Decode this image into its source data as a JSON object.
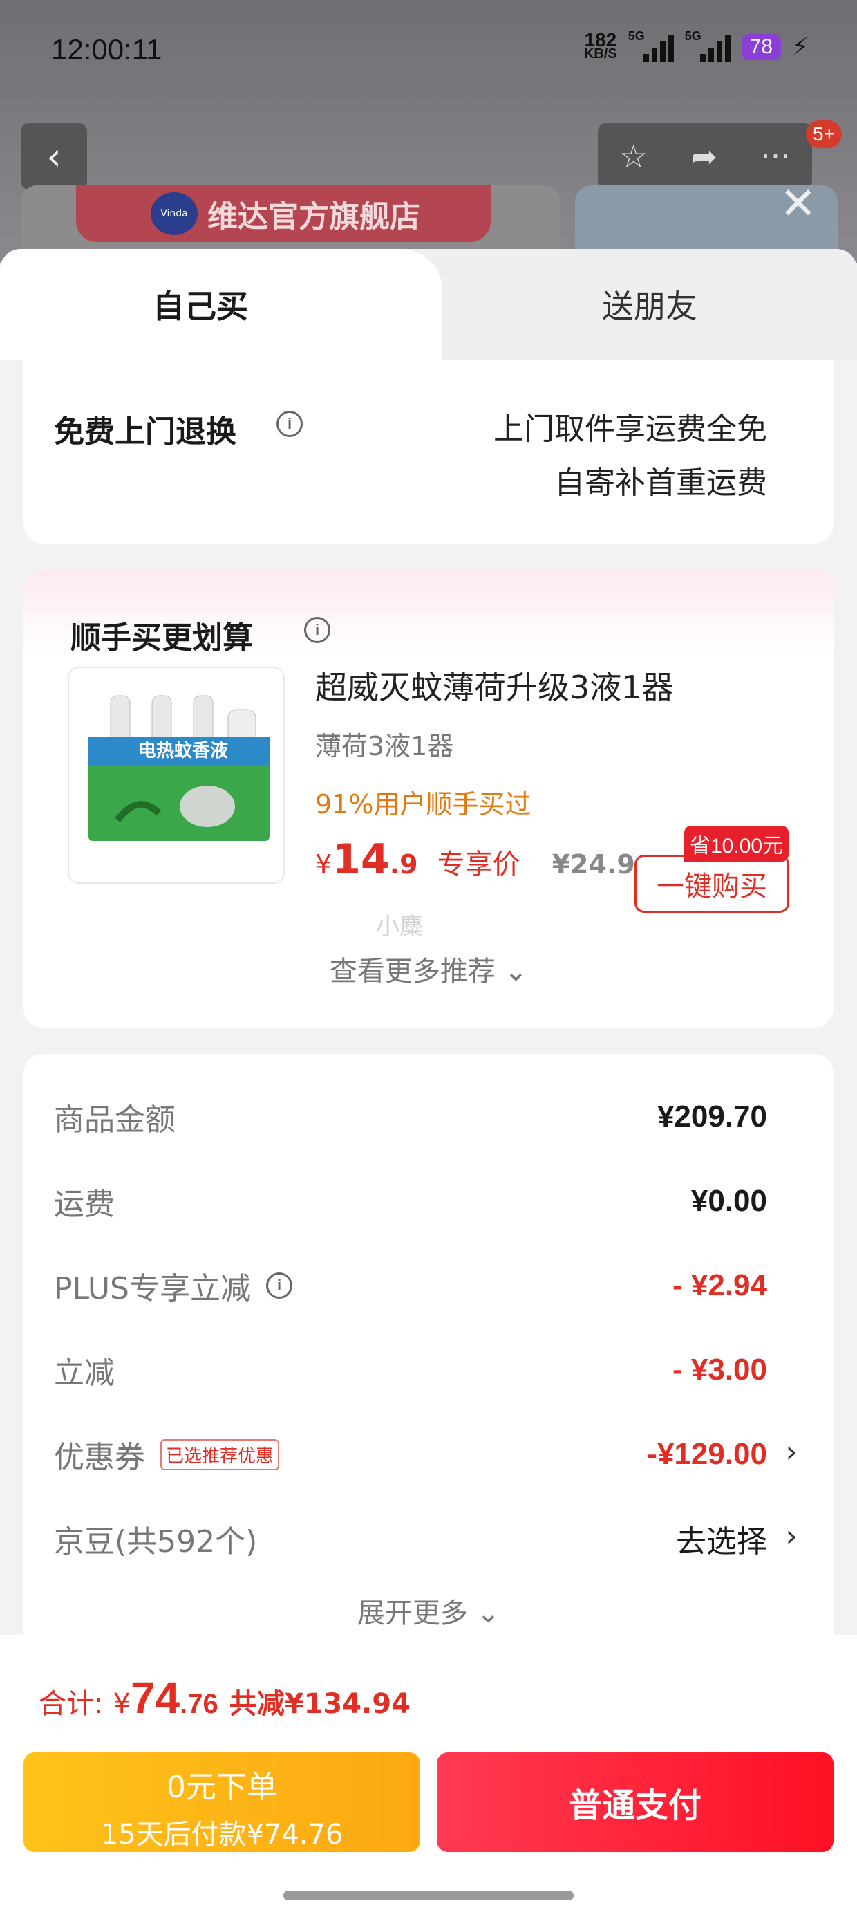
{
  "status_bar": {
    "time": "12:00:11",
    "speed_value": "182",
    "speed_unit": "KB/S",
    "net1": "5G",
    "net2": "5G",
    "battery": "78"
  },
  "background": {
    "store_name": "维达官方旗舰店",
    "logo_text": "Vinda",
    "badge": "5+"
  },
  "tabs": {
    "self": "自己买",
    "friend": "送朋友"
  },
  "return_card": {
    "title": "免费上门退换",
    "line1": "上门取件享运费全免",
    "line2": "自寄补首重运费"
  },
  "addon": {
    "title": "顺手买更划算",
    "product_name": "超威灭蚊薄荷升级3液1器",
    "spec": "薄荷3液1器",
    "stat": "91%用户顺手买过",
    "currency": "¥",
    "price_int": "14",
    "price_dec": ".9",
    "price_tag": "专享价",
    "orig_price": "¥24.9",
    "save_badge": "省10.00元",
    "buy_label": "一键购买",
    "watermark": "小麋",
    "more": "查看更多推荐",
    "img_text": "电热蚊香液"
  },
  "summary": {
    "rows": [
      {
        "label": "商品金额",
        "value": "¥209.70"
      },
      {
        "label": "运费",
        "value": "¥0.00"
      },
      {
        "label": "PLUS专享立减",
        "value": "- ¥2.94"
      },
      {
        "label": "立减",
        "value": "- ¥3.00"
      },
      {
        "label": "优惠券",
        "tag": "已选推荐优惠",
        "value": "-¥129.00"
      },
      {
        "label": "京豆(共592个)",
        "value": "去选择"
      }
    ],
    "expand": "展开更多"
  },
  "footer": {
    "total_label": "合计:",
    "currency": "¥",
    "total_int": "74",
    "total_dec": ".76",
    "reduced": "共减¥134.94",
    "zero_line1": "0元下单",
    "zero_line2": "15天后付款¥74.76",
    "pay_label": "普通支付"
  },
  "colors": {
    "accent_red": "#e02e24",
    "orange": "#e07a0f",
    "yellow_btn": "#fcb414",
    "pay_btn": "#ff1e38"
  }
}
